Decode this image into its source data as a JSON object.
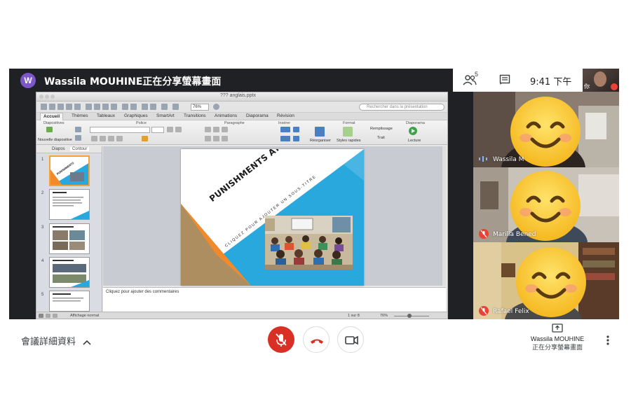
{
  "header": {
    "avatar_letter": "W",
    "share_title": "Wassila MOUHINE正在分享螢幕畫面",
    "people_count": "5",
    "time": "9:41 下午",
    "self_label": "你"
  },
  "app": {
    "doc_title": "??? anglais.pptx",
    "zoom": "76%",
    "search_placeholder": "Rechercher dans la présentation",
    "tabs": [
      "Accueil",
      "Thèmes",
      "Tableaux",
      "Graphiques",
      "SmartArt",
      "Transitions",
      "Animations",
      "Diaporama",
      "Révision"
    ],
    "ribbon_groups": [
      "Diapositives",
      "Police",
      "Paragraphe",
      "Insérer",
      "Format",
      "Diaporama"
    ],
    "new_slide_label": "Nouvelle diapositive",
    "reorder_label": "Réorganiser",
    "quick_styles_label": "Styles rapides",
    "fill_label": "Remplissage",
    "line_label": "Trait",
    "play_label": "Lecture",
    "panel_tabs": [
      "Diapos",
      "Contour"
    ],
    "slide_numbers": [
      "1",
      "2",
      "3",
      "4",
      "5"
    ],
    "slide_title": "PUNISHMENTS AT SCHOOL",
    "slide_subtitle": "CLIQUEZ POUR AJOUTER UN SOUS-TITRE",
    "notes_placeholder": "Cliquez pour ajouter des commentaires",
    "view_label": "Affichage normal",
    "page_indicator": "1 sur 8",
    "status_zoom": "76%"
  },
  "participants": [
    {
      "name": "Wassila M",
      "muted": false
    },
    {
      "name": "Marilia Bened",
      "muted": true
    },
    {
      "name": "Rafael Felix",
      "muted": true
    }
  ],
  "bottom": {
    "meeting_details": "會議詳細資料",
    "presenter_name": "Wassila MOUHINE",
    "presenter_sub": "正在分享螢幕畫面"
  },
  "colors": {
    "mic_off": "#d93025",
    "hangup_red": "#d93025",
    "slide_blue": "#29a8dd",
    "slide_orange": "#f28a2b"
  }
}
